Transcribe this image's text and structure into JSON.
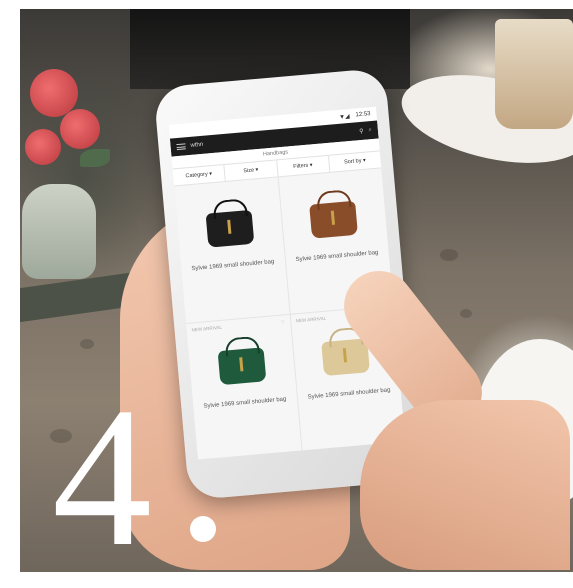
{
  "statusbar": {
    "time": "12:53"
  },
  "app": {
    "logo": "wthn",
    "breadcrumb": "Handbags",
    "filters": [
      "Category ▾",
      "Size ▾",
      "Filters ▾",
      "Sort by ▾"
    ],
    "products": [
      {
        "name": "Sylvie 1969 small shoulder bag",
        "color": "#1e1e1e",
        "trim": "#111111"
      },
      {
        "name": "Sylvie 1969 small shoulder bag",
        "color": "#8a4d2a",
        "trim": "#6d3a1d"
      },
      {
        "name": "Sylvie 1969 small shoulder bag",
        "color": "#1f5a3d",
        "trim": "#163f2b"
      },
      {
        "name": "Sylvie 1969 small shoulder bag",
        "color": "#ddc89a",
        "trim": "#c8b283"
      }
    ],
    "product_tag": "NEW ARRIVAL"
  },
  "overlay": {
    "numeral": "4"
  }
}
